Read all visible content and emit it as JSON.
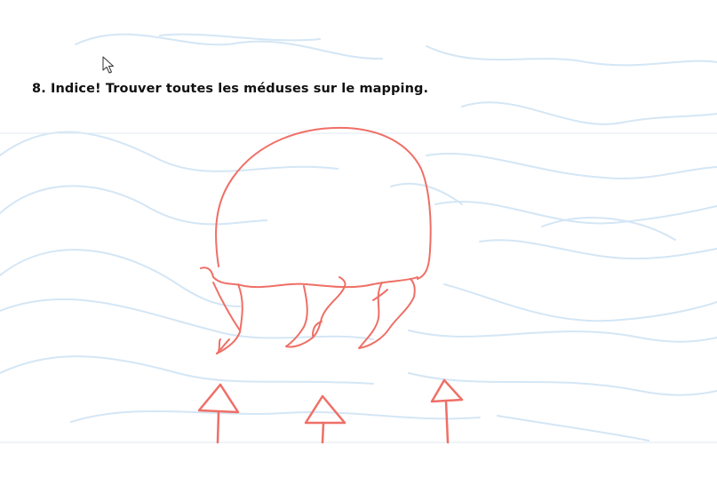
{
  "heading": {
    "text": "8. Indice! Trouver toutes les méduses sur le mapping."
  },
  "colors": {
    "sketch": "#ef6f66",
    "waves": "#d4e6f5",
    "rule_lines": "#dfe9f2",
    "text": "#111111",
    "background": "#ffffff"
  },
  "icons": {
    "cursor": "mouse-pointer-icon",
    "jellyfish": "jellyfish-sketch",
    "arrows": [
      "up-arrow-icon",
      "up-arrow-icon",
      "up-arrow-icon"
    ]
  }
}
